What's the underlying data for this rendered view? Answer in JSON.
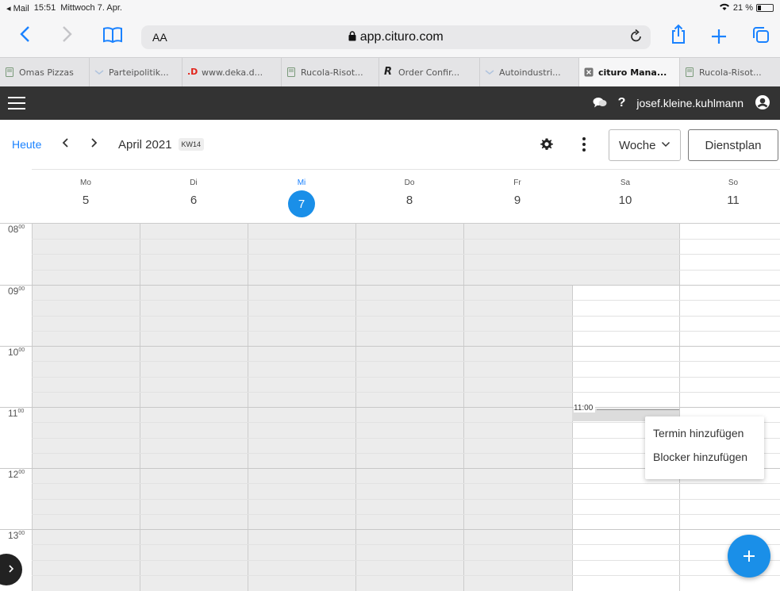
{
  "status_bar": {
    "back_app": "◂ Mail",
    "time": "15:51",
    "date": "Mittwoch 7. Apr.",
    "battery": "21 %"
  },
  "safari": {
    "reader_label": "AA",
    "url": "app.cituro.com"
  },
  "tabs": [
    {
      "label": "Omas Pizzas",
      "icon": "bookmark-icon",
      "active": false
    },
    {
      "label": "Parteipolitik...",
      "icon": "mail-icon",
      "active": false
    },
    {
      "label": "www.deka.d...",
      "icon": "deka-icon",
      "active": false
    },
    {
      "label": "Rucola-Risot...",
      "icon": "bookmark-icon",
      "active": false
    },
    {
      "label": "Order Confir...",
      "icon": "script-r-icon",
      "active": false
    },
    {
      "label": "Autoindustri...",
      "icon": "mail-icon",
      "active": false
    },
    {
      "label": "cituro Mana...",
      "icon": "close-tab-icon",
      "active": true
    },
    {
      "label": "Rucola-Risot...",
      "icon": "bookmark-icon",
      "active": false
    }
  ],
  "appbar": {
    "help_label": "?",
    "username": "josef.kleine.kuhlmann"
  },
  "calendar": {
    "today_label": "Heute",
    "month_label": "April 2021",
    "week_badge": "KW14",
    "view_select": "Woche",
    "dienstplan_label": "Dienstplan",
    "days": [
      {
        "name": "Mo",
        "num": "5",
        "today": false
      },
      {
        "name": "Di",
        "num": "6",
        "today": false
      },
      {
        "name": "Mi",
        "num": "7",
        "today": true
      },
      {
        "name": "Do",
        "num": "8",
        "today": false
      },
      {
        "name": "Fr",
        "num": "9",
        "today": false
      },
      {
        "name": "Sa",
        "num": "10",
        "today": false
      },
      {
        "name": "So",
        "num": "11",
        "today": false
      }
    ],
    "hours": [
      "08",
      "09",
      "10",
      "11",
      "12",
      "13"
    ],
    "hour_suffix": "00",
    "selected_slot_time": "11:00"
  },
  "context_menu": {
    "items": [
      "Termin hinzufügen",
      "Blocker hinzufügen"
    ]
  },
  "colors": {
    "accent": "#1a8fe8",
    "link": "#1a82ff",
    "appbar_bg": "#333333",
    "off_hours": "#ececec"
  }
}
